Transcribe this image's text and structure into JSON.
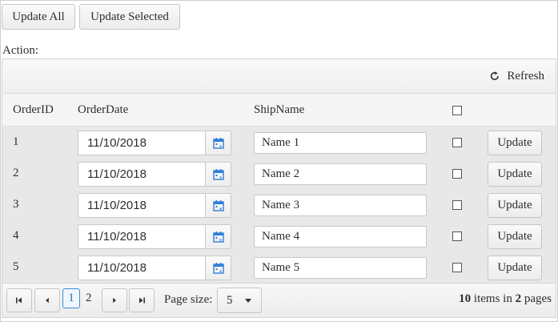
{
  "toolbar": {
    "update_all": "Update All",
    "update_selected": "Update Selected"
  },
  "action_label": "Action:",
  "grid": {
    "refresh_label": "Refresh",
    "columns": {
      "order_id": "OrderID",
      "order_date": "OrderDate",
      "ship_name": "ShipName"
    },
    "rows": [
      {
        "id": "1",
        "date": "11/10/2018",
        "ship": "Name 1",
        "checked": false,
        "button": "Update"
      },
      {
        "id": "2",
        "date": "11/10/2018",
        "ship": "Name 2",
        "checked": false,
        "button": "Update"
      },
      {
        "id": "3",
        "date": "11/10/2018",
        "ship": "Name 3",
        "checked": false,
        "button": "Update"
      },
      {
        "id": "4",
        "date": "11/10/2018",
        "ship": "Name 4",
        "checked": false,
        "button": "Update"
      },
      {
        "id": "5",
        "date": "11/10/2018",
        "ship": "Name 5",
        "checked": false,
        "button": "Update"
      }
    ]
  },
  "pager": {
    "page_1": "1",
    "page_2": "2",
    "page_size_label": "Page size:",
    "page_size": "5",
    "total_items": "10",
    "items_text": " items in ",
    "total_pages": "2",
    "pages_text": " pages"
  },
  "colors": {
    "accent": "#3a8bd9",
    "calendar_icon": "#2f7ed8"
  }
}
